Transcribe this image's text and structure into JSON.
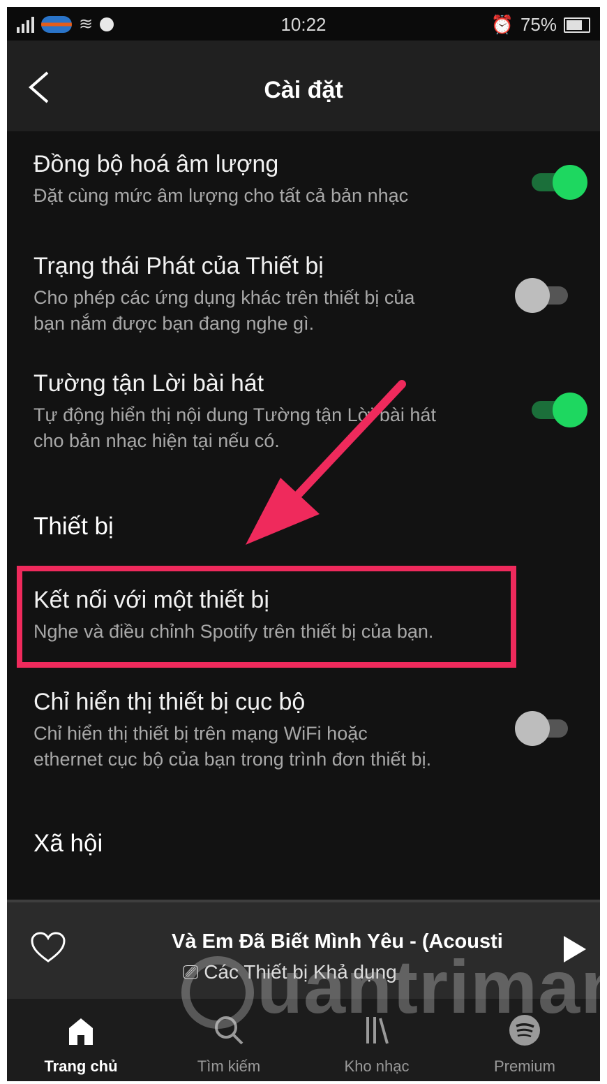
{
  "status_bar": {
    "time": "10:22",
    "battery": "75%"
  },
  "app_bar": {
    "title": "Cài đặt"
  },
  "settings": [
    {
      "title": "Đồng bộ hoá âm lượng",
      "subtitle": "Đặt cùng mức âm lượng cho tất cả bản nhạc",
      "toggle": true
    },
    {
      "title": "Trạng thái Phát của Thiết bị",
      "subtitle_line1": "Cho phép các ứng dụng khác trên thiết bị của",
      "subtitle_line2": "bạn nắm được bạn đang nghe gì.",
      "toggle": false
    },
    {
      "title": "Tường tận Lời bài hát",
      "subtitle_line1": "Tự động hiển thị nội dung Tường tận Lời bài hát",
      "subtitle_line2": "cho bản nhạc hiện tại nếu có.",
      "toggle": true
    }
  ],
  "section_devices": "Thiết bị",
  "connect_device": {
    "title": "Kết nối với một thiết bị",
    "subtitle": "Nghe và điều chỉnh Spotify trên thiết bị của bạn."
  },
  "local_devices": {
    "title": "Chỉ hiển thị thiết bị cục bộ",
    "subtitle_line1": "Chỉ hiển thị thiết bị trên mạng WiFi hoặc",
    "subtitle_line2": "ethernet cục bộ của bạn trong trình đơn thiết bị.",
    "toggle": false
  },
  "section_social": "Xã hội",
  "now_playing": {
    "title": "Và Em Đã Biết Mình Yêu - (Acousti",
    "subtitle": "Các Thiết bị Khả dụng"
  },
  "bottom_nav": [
    {
      "label": "Trang chủ",
      "icon": "home-icon",
      "active": true
    },
    {
      "label": "Tìm kiếm",
      "icon": "search-icon",
      "active": false
    },
    {
      "label": "Kho nhạc",
      "icon": "library-icon",
      "active": false
    },
    {
      "label": "Premium",
      "icon": "spotify-icon",
      "active": false
    }
  ],
  "watermark": "uantrimang",
  "colors": {
    "accent_green": "#1ed760",
    "highlight_pink": "#ef2a5c",
    "background": "#121212"
  }
}
